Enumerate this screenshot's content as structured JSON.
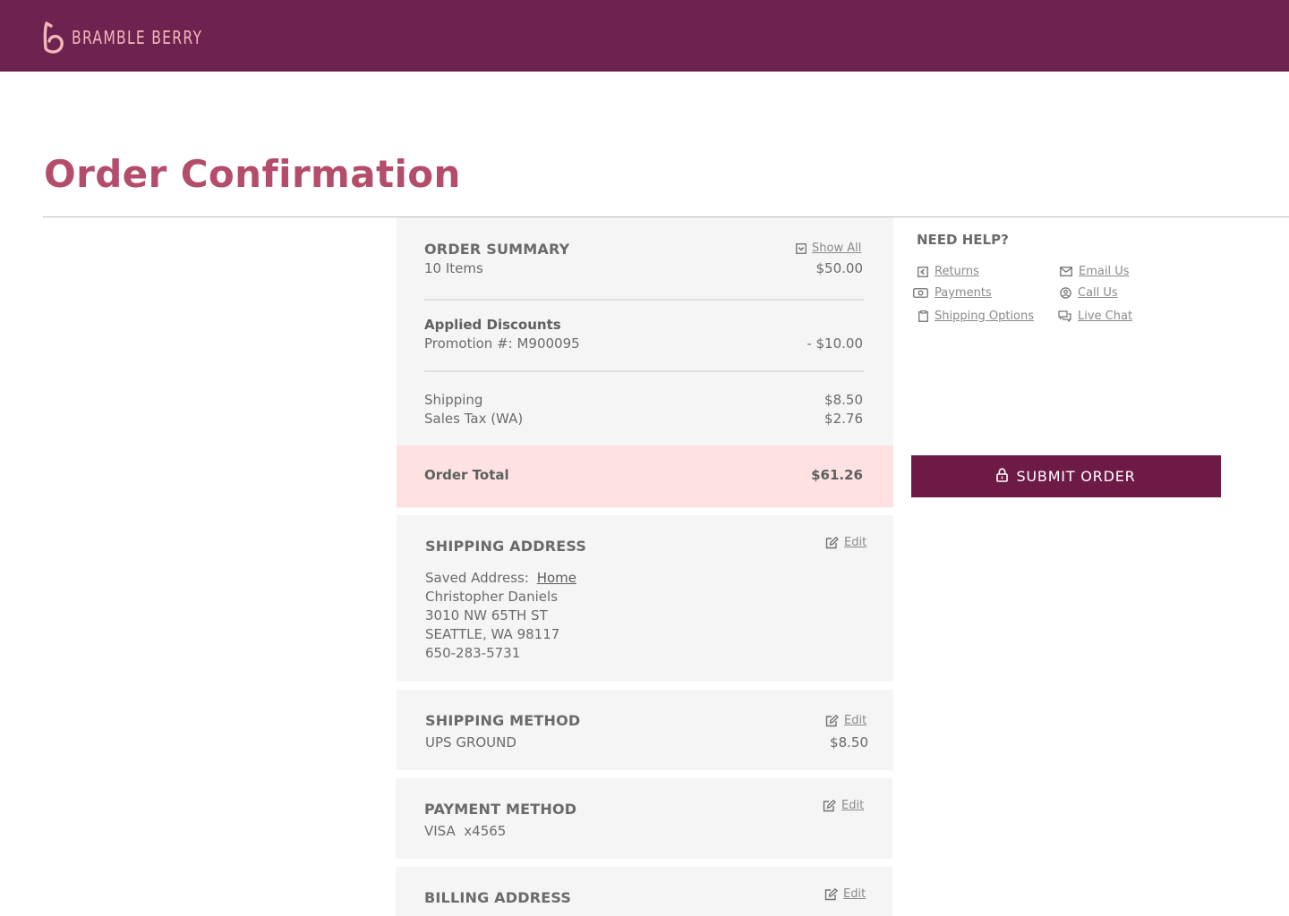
{
  "brand": {
    "name": "BRAMBLE BERRY",
    "mark": "b",
    "colors": {
      "header": "#6e2250",
      "accent": "#b44d6a",
      "logo": "#f4b7b9",
      "button": "#6e1a46",
      "total_band": "#fde2e1"
    }
  },
  "page": {
    "title": "Order Confirmation"
  },
  "order_summary": {
    "title": "ORDER SUMMARY",
    "show_all_label": "Show All",
    "items_label": "10 Items",
    "items_amount": "$50.00",
    "discounts_title": "Applied Discounts",
    "promotion_label": "Promotion #: M900095",
    "promotion_amount": "- $10.00",
    "shipping_label": "Shipping",
    "shipping_amount": "$8.50",
    "tax_label": "Sales Tax (WA)",
    "tax_amount": "$2.76",
    "total_label": "Order Total",
    "total_amount": "$61.26"
  },
  "shipping_address": {
    "title": "SHIPPING ADDRESS",
    "edit_label": "Edit",
    "saved_prefix": "Saved Address:",
    "saved_name": "Home",
    "name": "Christopher Daniels",
    "line1": "3010 NW 65TH ST",
    "line2": "SEATTLE, WA 98117",
    "phone": "650-283-5731"
  },
  "shipping_method": {
    "title": "SHIPPING METHOD",
    "edit_label": "Edit",
    "method": "UPS GROUND",
    "amount": "$8.50"
  },
  "payment_method": {
    "title": "PAYMENT METHOD",
    "edit_label": "Edit",
    "card": "VISA  x4565"
  },
  "billing_address": {
    "title": "BILLING ADDRESS",
    "edit_label": "Edit"
  },
  "help": {
    "title": "NEED HELP?",
    "links": [
      {
        "label": "Returns",
        "icon": "returns-icon"
      },
      {
        "label": "Email Us",
        "icon": "email-icon"
      },
      {
        "label": "Payments",
        "icon": "payments-icon"
      },
      {
        "label": "Call Us",
        "icon": "phone-icon"
      },
      {
        "label": "Shipping Options",
        "icon": "shipping-icon"
      },
      {
        "label": "Live Chat",
        "icon": "chat-icon"
      }
    ]
  },
  "actions": {
    "submit_label": "SUBMIT ORDER",
    "submit_icon": "lock-icon"
  }
}
